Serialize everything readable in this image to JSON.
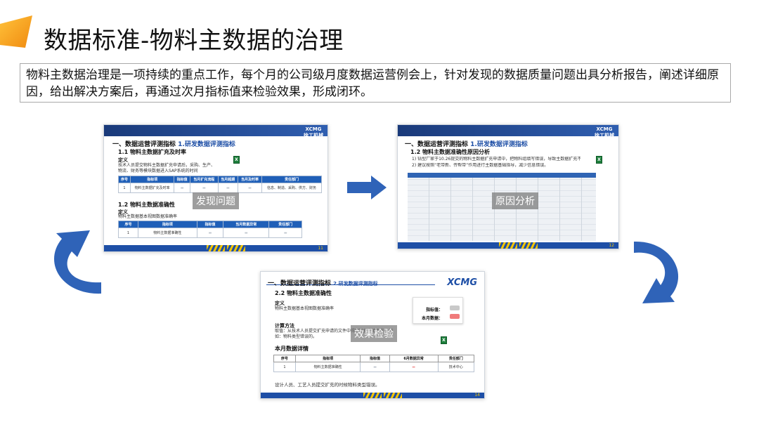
{
  "page": {
    "title": "数据标准-物料主数据的治理",
    "intro": "物料主数据治理是一项持续的重点工作，每个月的公司级月度数据运营例会上，针对发现的数据质量问题出具分析报告，阐述详细原因，给出解决方案后，再通过次月指标值来检验效果，形成闭环。"
  },
  "colors": {
    "accent_orange": "#f7a21b",
    "arrow_blue": "#2f63b8",
    "brand_blue": "#1e4fa6"
  },
  "slides": {
    "find": {
      "overlay": "发现问题",
      "brand": [
        "XCMG",
        "徐工机械"
      ],
      "sec_title": "一、数据运营评测指标",
      "sec_title_hl": "1.研发数据评测指标",
      "sub1": "1.1 物料主数据扩充及时率",
      "def_label": "定义",
      "def_text": "技术人员提交物料主数据扩充申请后，采购、生产、物流、财务等模块数据进入SAP系统的时间",
      "table1": {
        "headers": [
          "序号",
          "指标项",
          "指标值",
          "当月扩充流程",
          "当月超期",
          "当月及时率",
          "责任部门"
        ],
        "row": [
          "1",
          "物料主数据扩充及时率",
          "",
          "",
          "",
          "",
          "信息、制造、采购、供方、财务"
        ]
      },
      "sub2": "1.2 物料主数据准确性",
      "def2_label": "定义",
      "def2_text": "物料主数据基本视图数据准确率",
      "table2": {
        "headers": [
          "序号",
          "指标项",
          "指标值",
          "当月数据异常",
          "责任部门"
        ],
        "row": [
          "1",
          "物料主数据准确性",
          "",
          "",
          ""
        ]
      },
      "page_num": "11"
    },
    "analyze": {
      "overlay": "原因分析",
      "brand": [
        "XCMG",
        "徐工机械"
      ],
      "sec_title": "一、数据运营评测指标",
      "sec_title_hl": "1.研发数据评测指标",
      "sub1": "1.2 物料主数据准确性原因分析",
      "point1": "1) 钻型厂家于10.26提交的物料主数据扩充申请中，把物料组填写错误，导致主数据扩充不成功。",
      "point2": "2) 建议按照“老带新、传帮带”作用进行主数据基础指导，减少信息错误。",
      "page_num": "12"
    },
    "verify": {
      "overlay": "效果检验",
      "brand": "XCMG",
      "sec_title": "一、数据运营评测指标",
      "sec_title_hl": "2.研发数据评测指标",
      "sub1": "2.2 物料主数据准确性",
      "def_label": "定义",
      "def_text": "物料主数据基本视图数据准确率",
      "calc_label": "计算方法",
      "calc_text": "取值：从技术人员提交扩充申请的文件中得到数据准确性的、例如：物料类型错误的。",
      "result_lbl1": "指标值：",
      "result_lbl2": "本月数据：",
      "detail_label": "本月数据详情",
      "table": {
        "headers": [
          "序号",
          "指标项",
          "指标值",
          "6月数据异常",
          "责任部门"
        ],
        "row": [
          "1",
          "物料主数据准确性",
          "",
          "",
          "技术中心"
        ]
      },
      "footnote": "设计人员、工艺人员提交扩充的时候物料类型错误。",
      "page_num": "14"
    }
  }
}
